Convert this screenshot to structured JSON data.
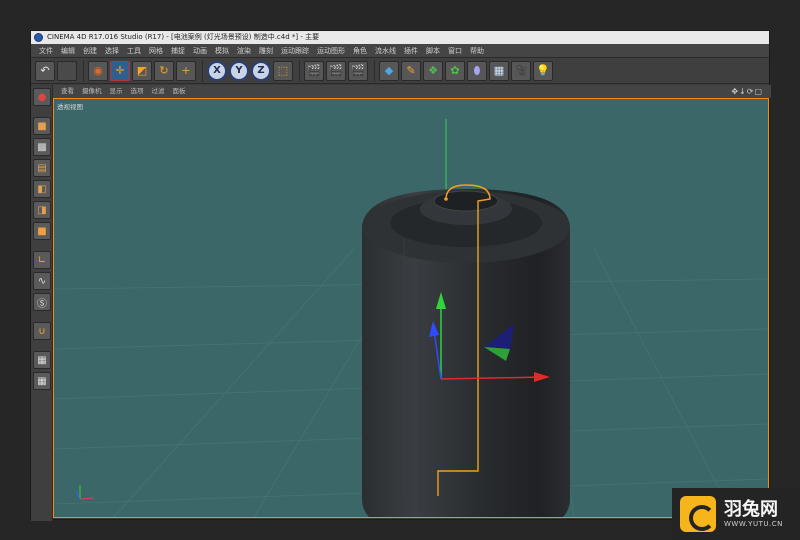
{
  "window": {
    "title": "CINEMA 4D R17.016 Studio (R17) - [电池案例 (灯光场景预设) 制造中.c4d *] - 主要"
  },
  "menu": [
    "文件",
    "编辑",
    "创建",
    "选择",
    "工具",
    "网格",
    "捕捉",
    "动画",
    "模拟",
    "渲染",
    "雕刻",
    "运动跟踪",
    "运动图形",
    "角色",
    "流水线",
    "插件",
    "脚本",
    "窗口",
    "帮助"
  ],
  "toolbar": {
    "undo_icon": "undo-icon",
    "axis_x": "X",
    "axis_y": "Y",
    "axis_z": "Z"
  },
  "viewport": {
    "menu": [
      "查看",
      "摄像机",
      "显示",
      "选项",
      "过滤",
      "面板"
    ],
    "label": "透视视图",
    "background_color": "#3b6768",
    "controls": "✥↓⟳▢"
  },
  "watermark": {
    "name": "羽兔网",
    "url": "WWW.YUTU.CN",
    "accent": "#f5b51b"
  }
}
